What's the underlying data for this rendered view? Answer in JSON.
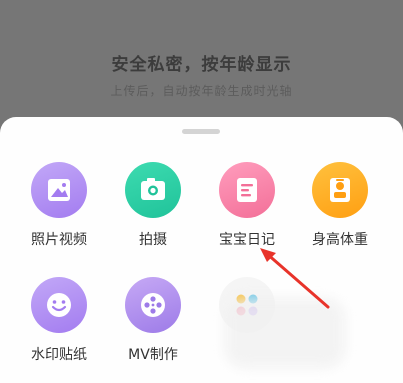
{
  "backdrop": {
    "title": "安全私密，按年龄显示",
    "subtitle": "上传后，自动按年龄生成时光轴"
  },
  "menu": {
    "items": [
      {
        "label": "照片视频",
        "icon": "photo-icon",
        "color": "#b395f5"
      },
      {
        "label": "拍摄",
        "icon": "camera-icon",
        "color": "#2dd1a6"
      },
      {
        "label": "宝宝日记",
        "icon": "diary-icon",
        "color": "#f77fa6"
      },
      {
        "label": "身高体重",
        "icon": "growth-icon",
        "color": "#ffb126"
      },
      {
        "label": "水印贴纸",
        "icon": "smiley-sticker-icon",
        "color": "#b395f5"
      },
      {
        "label": "MV制作",
        "icon": "film-reel-icon",
        "color": "#b08ef0"
      },
      {
        "label": "",
        "icon": "more-apps-icon",
        "color": "#f2f2f2"
      }
    ]
  },
  "annotation": {
    "color": "#e8332a",
    "icon": "red-arrow-pointer"
  }
}
